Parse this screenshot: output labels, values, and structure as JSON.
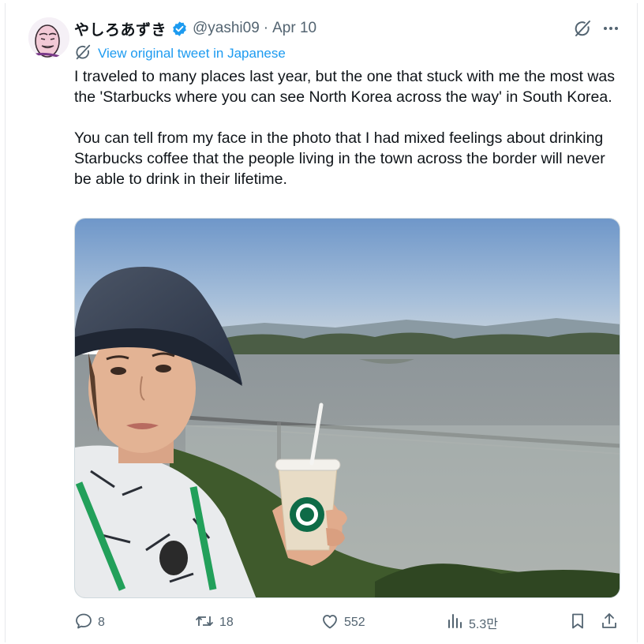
{
  "tweet": {
    "display_name": "やしろあずき",
    "handle": "@yashi09",
    "separator": "·",
    "date": "Apr 10",
    "translate_label": "View original tweet in Japanese",
    "paragraph_1": "I traveled to many places last year, but the one that stuck with me the most was the 'Starbucks where you can see North Korea across the way' in South Korea.",
    "paragraph_2": "You can tell from my face in the photo that I had mixed feelings about drinking Starbucks coffee that the people living in the town across the border will never be able to drink in their lifetime."
  },
  "actions": {
    "replies": "8",
    "reposts": "18",
    "likes": "552",
    "views": "5.3만"
  },
  "colors": {
    "link": "#1d9bf0",
    "secondary_text": "#536471",
    "verified": "#1d9bf0"
  },
  "icons": [
    "verified-badge-icon",
    "grok-icon",
    "more-icon",
    "translate-icon",
    "reply-icon",
    "repost-icon",
    "like-icon",
    "views-icon",
    "bookmark-icon",
    "share-icon"
  ]
}
